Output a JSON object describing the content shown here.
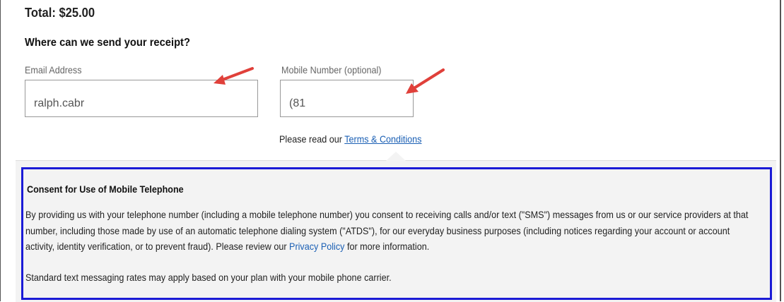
{
  "total": "Total: $25.00",
  "receipt_question": "Where can we send your receipt?",
  "email": {
    "label": "Email Address",
    "value": "ralph.cabr"
  },
  "mobile": {
    "label": "Mobile Number (optional)",
    "value": "(81"
  },
  "terms": {
    "prefix": "Please read our ",
    "link": "Terms & Conditions"
  },
  "consent": {
    "title": "Consent for Use of Mobile Telephone",
    "body_before_link": "By providing us with your telephone number (including a mobile telephone number) you consent to receiving calls and/or text (\"SMS\") messages from us or our service providers at that number, including those made by use of an automatic telephone dialing system (\"ATDS\"), for our everyday business purposes (including notices regarding your account or account activity, identity verification, or to prevent fraud). Please review our ",
    "privacy_link": "Privacy Policy",
    "body_after_link": " for more information.",
    "footer": "Standard text messaging rates may apply based on your plan with your mobile phone carrier."
  },
  "colors": {
    "link": "#1a5fb4",
    "annotation_arrow": "#e0403a",
    "highlight_border": "#1b1bd6",
    "panel_bg": "#f3f3f3"
  }
}
